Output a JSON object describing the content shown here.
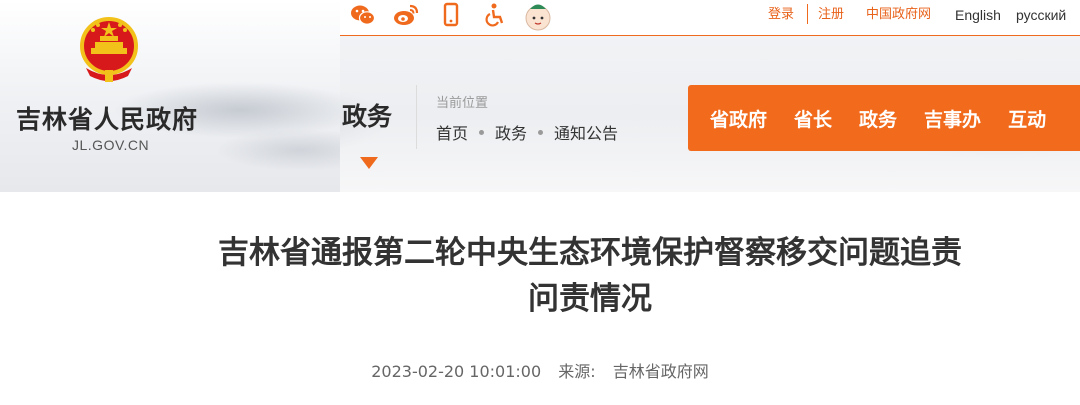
{
  "site": {
    "name": "吉林省人民政府",
    "domain": "JL.GOV.CN"
  },
  "topbar": {
    "icons": [
      "wechat-icon",
      "weibo-icon",
      "mobile-icon",
      "accessibility-icon",
      "mascot-icon"
    ],
    "links": {
      "login": "登录",
      "register": "注册",
      "china_gov": "中国政府网",
      "english": "English",
      "russian": "русский"
    }
  },
  "section": {
    "label": "政务"
  },
  "breadcrumb": {
    "label": "当前位置",
    "items": [
      "首页",
      "政务",
      "通知公告"
    ]
  },
  "nav": {
    "items": [
      "省政府",
      "省长",
      "政务",
      "吉事办",
      "互动"
    ]
  },
  "article": {
    "title_line1": "吉林省通报第二轮中央生态环境保护督察移交问题追责",
    "title_line2": "问责情况",
    "datetime": "2023-02-20 10:01:00",
    "source_label": "来源:",
    "source": "吉林省政府网"
  },
  "colors": {
    "accent": "#f26b1c",
    "emblem_red": "#d7191c",
    "emblem_gold": "#f2c21b"
  }
}
